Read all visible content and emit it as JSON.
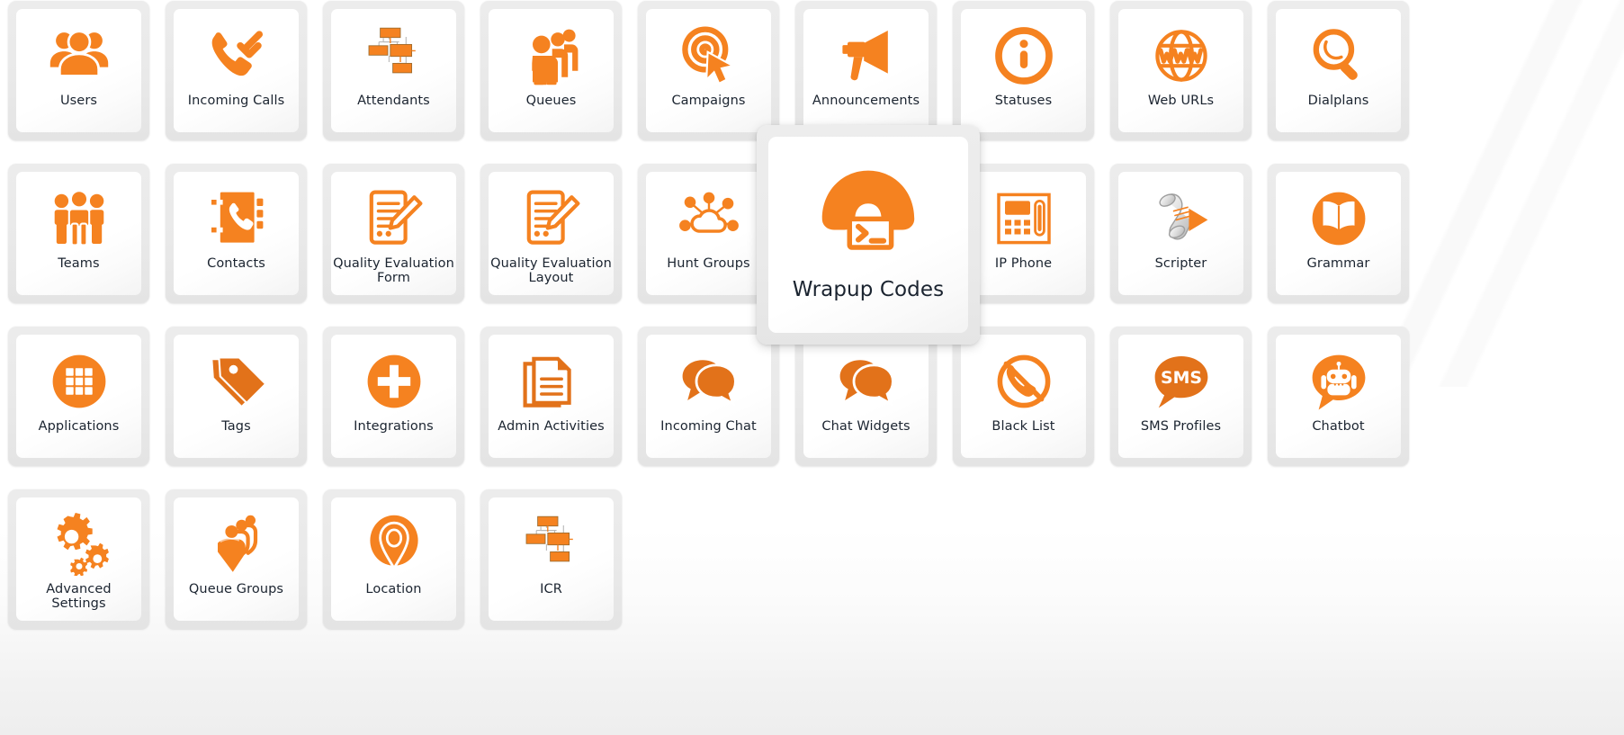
{
  "theme": {
    "accent_orange": "#F58220",
    "accent_orange_dark": "#E2721A",
    "tile_frame_gray": "#EAEAEA",
    "card_white": "#FFFFFF",
    "label_text": "#1B2430",
    "scripter_silver": "#D6D6D6"
  },
  "grid": {
    "columns": 9,
    "rows": 4,
    "tiles": [
      {
        "label": "Users",
        "icon": "users-icon",
        "row": 1,
        "col": 1
      },
      {
        "label": "Incoming Calls",
        "icon": "incoming-call-icon",
        "row": 1,
        "col": 2
      },
      {
        "label": "Attendants",
        "icon": "flowchart-icon",
        "row": 1,
        "col": 3
      },
      {
        "label": "Queues",
        "icon": "queue-people-icon",
        "row": 1,
        "col": 4
      },
      {
        "label": "Campaigns",
        "icon": "target-cursor-icon",
        "row": 1,
        "col": 5
      },
      {
        "label": "Announcements",
        "icon": "megaphone-icon",
        "row": 1,
        "col": 6
      },
      {
        "label": "Statuses",
        "icon": "info-circle-icon",
        "row": 1,
        "col": 7
      },
      {
        "label": "Web URLs",
        "icon": "www-globe-icon",
        "row": 1,
        "col": 8
      },
      {
        "label": "Dialplans",
        "icon": "magnifier-icon",
        "row": 1,
        "col": 9
      },
      {
        "label": "Teams",
        "icon": "team-group-icon",
        "row": 2,
        "col": 1
      },
      {
        "label": "Contacts",
        "icon": "phonebook-icon",
        "row": 2,
        "col": 2
      },
      {
        "label": "Quality Evaluation\nForm",
        "icon": "form-pencil-icon",
        "row": 2,
        "col": 3
      },
      {
        "label": "Quality Evaluation\nLayout",
        "icon": "form-pencil-icon",
        "row": 2,
        "col": 4
      },
      {
        "label": "Hunt Groups",
        "icon": "cloud-network-icon",
        "row": 2,
        "col": 5
      },
      {
        "label": "Wrapup Codes",
        "icon": "handset-terminal-icon",
        "row": 2,
        "col": 6
      },
      {
        "label": "IP Phone",
        "icon": "desk-phone-icon",
        "row": 2,
        "col": 7
      },
      {
        "label": "Scripter",
        "icon": "scroll-play-icon",
        "row": 2,
        "col": 8
      },
      {
        "label": "Grammar",
        "icon": "open-book-icon",
        "row": 2,
        "col": 9
      },
      {
        "label": "Applications",
        "icon": "app-grid-icon",
        "row": 3,
        "col": 1
      },
      {
        "label": "Tags",
        "icon": "tags-icon",
        "row": 3,
        "col": 2
      },
      {
        "label": "Integrations",
        "icon": "plus-circle-icon",
        "row": 3,
        "col": 3
      },
      {
        "label": "Admin Activities",
        "icon": "documents-icon",
        "row": 3,
        "col": 4
      },
      {
        "label": "Incoming Chat",
        "icon": "chat-bubbles-icon",
        "row": 3,
        "col": 5
      },
      {
        "label": "Chat Widgets",
        "icon": "chat-bubbles-icon",
        "row": 3,
        "col": 6
      },
      {
        "label": "Black List",
        "icon": "no-call-icon",
        "row": 3,
        "col": 7
      },
      {
        "label": "SMS Profiles",
        "icon": "sms-bubble-icon",
        "row": 3,
        "col": 8
      },
      {
        "label": "Chatbot",
        "icon": "chatbot-icon",
        "row": 3,
        "col": 9
      },
      {
        "label": "Advanced\nSettings",
        "icon": "gears-icon",
        "row": 4,
        "col": 1
      },
      {
        "label": "Queue Groups",
        "icon": "queue-groups-icon",
        "row": 4,
        "col": 2
      },
      {
        "label": "Location",
        "icon": "map-pin-icon",
        "row": 4,
        "col": 3
      },
      {
        "label": "ICR",
        "icon": "flowchart-icon",
        "row": 4,
        "col": 4
      }
    ]
  },
  "hover_popup": {
    "label": "Wrapup Codes",
    "icon": "handset-terminal-icon",
    "state": "hovered"
  }
}
